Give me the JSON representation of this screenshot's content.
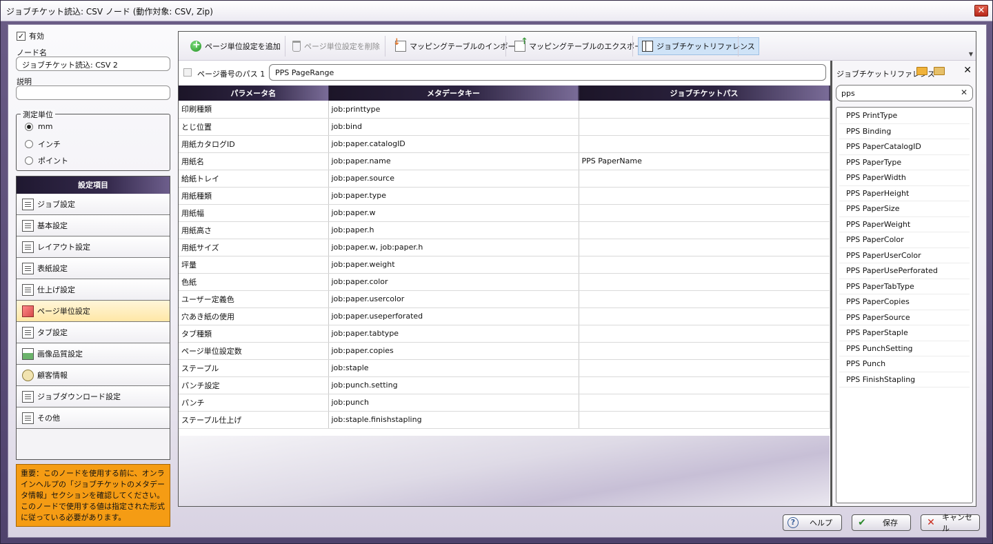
{
  "window": {
    "title": "ジョブチケット読込: CSV ノード (動作対象: CSV, Zip)",
    "close_glyph": "✕"
  },
  "left": {
    "enabled_label": "有効",
    "enabled_check": "✓",
    "node_name_label": "ノード名",
    "node_name_value": "ジョブチケット読込: CSV 2",
    "description_label": "説明",
    "description_value": "",
    "units": {
      "legend": "測定単位",
      "options": [
        "mm",
        "インチ",
        "ポイント"
      ],
      "selected": "mm"
    },
    "settings": {
      "header": "設定項目",
      "items": [
        {
          "label": "ジョブ設定",
          "icon": "document-icon"
        },
        {
          "label": "基本設定",
          "icon": "list-icon"
        },
        {
          "label": "レイアウト設定",
          "icon": "layout-icon"
        },
        {
          "label": "表紙設定",
          "icon": "cover-icon"
        },
        {
          "label": "仕上げ設定",
          "icon": "finishing-icon"
        },
        {
          "label": "ページ単位設定",
          "icon": "page-icon"
        },
        {
          "label": "タブ設定",
          "icon": "tab-icon"
        },
        {
          "label": "画像品質設定",
          "icon": "image-icon"
        },
        {
          "label": "顧客情報",
          "icon": "customer-icon"
        },
        {
          "label": "ジョブダウンロード設定",
          "icon": "download-icon"
        },
        {
          "label": "その他",
          "icon": "other-icon"
        }
      ],
      "selected": "ページ単位設定"
    },
    "notice": "重要：このノードを使用する前に、オンラインヘルプの「ジョブチケットのメタデータ情報」セクションを確認してください。このノードで使用する値は指定された形式に従っている必要があります。"
  },
  "toolbar": {
    "add_label": "ページ単位設定を追加",
    "delete_label": "ページ単位設定を削除",
    "import_label": "マッピングテーブルのインポート",
    "export_label": "マッピングテーブルのエクスポート",
    "reference_label": "ジョブチケットリファレンス",
    "more_glyph": "▼"
  },
  "page_path": {
    "label": "ページ番号のパス 1",
    "value": "PPS PageRange"
  },
  "grid": {
    "headers": [
      "パラメータ名",
      "メタデータキー",
      "ジョブチケットパス"
    ],
    "rows": [
      [
        "印刷種類",
        "job:printtype",
        ""
      ],
      [
        "とじ位置",
        "job:bind",
        ""
      ],
      [
        "用紙カタログID",
        "job:paper.catalogID",
        ""
      ],
      [
        "用紙名",
        "job:paper.name",
        "PPS PaperName"
      ],
      [
        "給紙トレイ",
        "job:paper.source",
        ""
      ],
      [
        "用紙種類",
        "job:paper.type",
        ""
      ],
      [
        "用紙幅",
        "job:paper.w",
        ""
      ],
      [
        "用紙高さ",
        "job:paper.h",
        ""
      ],
      [
        "用紙サイズ",
        "job:paper.w, job:paper.h",
        ""
      ],
      [
        "坪量",
        "job:paper.weight",
        ""
      ],
      [
        "色紙",
        "job:paper.color",
        ""
      ],
      [
        "ユーザー定義色",
        "job:paper.usercolor",
        ""
      ],
      [
        "穴あき紙の使用",
        "job:paper.useperforated",
        ""
      ],
      [
        "タブ種類",
        "job:paper.tabtype",
        ""
      ],
      [
        "ページ単位設定数",
        "job:paper.copies",
        ""
      ],
      [
        "ステープル",
        "job:staple",
        ""
      ],
      [
        "パンチ設定",
        "job:punch.setting",
        ""
      ],
      [
        "パンチ",
        "job:punch",
        ""
      ],
      [
        "ステープル仕上げ",
        "job:staple.finishstapling",
        ""
      ]
    ]
  },
  "reference": {
    "title": "ジョブチケットリファレンス",
    "close_glyph": "✕",
    "search_value": "pps",
    "clear_glyph": "✕",
    "items": [
      "PPS PrintType",
      "PPS Binding",
      "PPS PaperCatalogID",
      "PPS PaperType",
      "PPS PaperWidth",
      "PPS PaperHeight",
      "PPS PaperSize",
      "PPS PaperWeight",
      "PPS PaperColor",
      "PPS PaperUserColor",
      "PPS PaperUsePerforated",
      "PPS PaperTabType",
      "PPS PaperCopies",
      "PPS PaperSource",
      "PPS PaperStaple",
      "PPS PunchSetting",
      "PPS Punch",
      "PPS FinishStapling"
    ]
  },
  "buttons": {
    "help_label": "ヘルプ",
    "save_label": "保存",
    "cancel_label": "キャンセル",
    "help_glyph": "?",
    "save_glyph": "✔",
    "cancel_glyph": "✕"
  },
  "colors": {
    "frame": "#5b4d78",
    "header_dark": "#1c1528",
    "selected_item": "#ffe7a6",
    "notice": "#f59c14",
    "active_tool": "#cfe3f7"
  }
}
